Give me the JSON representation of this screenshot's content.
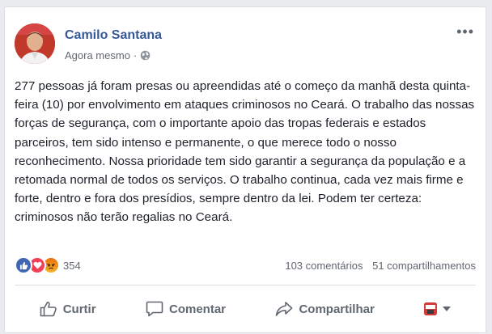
{
  "post": {
    "author": "Camilo Santana",
    "time": "Agora mesmo",
    "privacy_icon": "globe-icon",
    "more_label": "•••",
    "text": "277 pessoas já foram presas ou apreendidas até o começo da manhã desta quinta-feira (10) por envolvimento em ataques criminosos no Ceará. O trabalho das nossas forças de segurança, com o importante apoio das tropas federais e estados parceiros, tem sido intenso e permanente, o que merece todo o nosso reconhecimento. Nossa prioridade tem sido garantir a segurança da população e a retomada normal de todos os serviços. O trabalho continua, cada vez mais firme e forte, dentro e fora dos presídios, sempre dentro da lei. Podem ter certeza: criminosos não terão regalias no Ceará."
  },
  "stats": {
    "reactions_count": "354",
    "comments": "103 comentários",
    "shares": "51 compartilhamentos"
  },
  "actions": {
    "like": "Curtir",
    "comment": "Comentar",
    "share": "Compartilhar"
  },
  "colors": {
    "author_link": "#365899",
    "like_blue": "#4267b2",
    "love_red": "#f33e58",
    "angry_orange": "#e9710f"
  }
}
